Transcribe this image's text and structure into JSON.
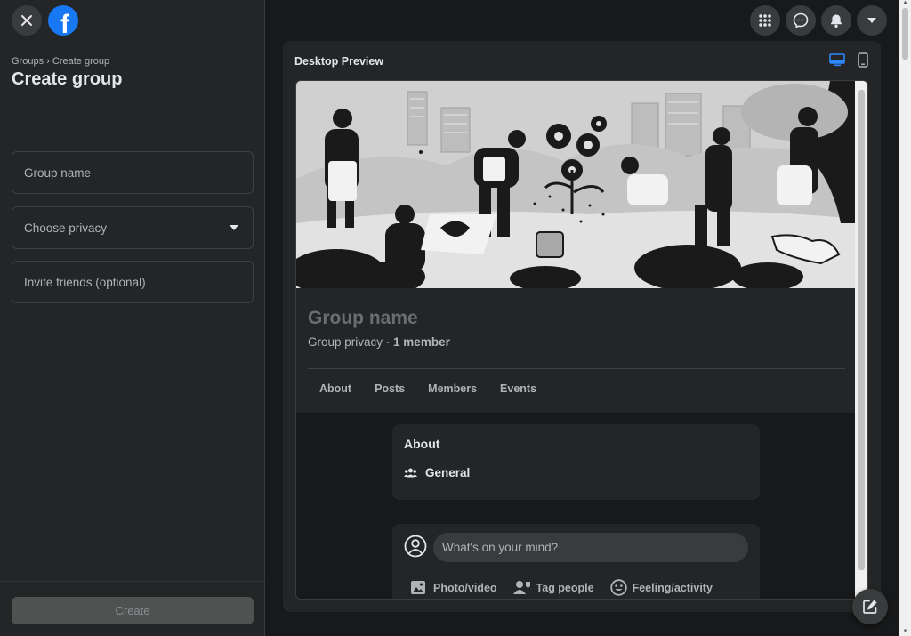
{
  "left": {
    "breadcrumb": {
      "groups": "Groups",
      "separator": "›",
      "current": "Create group"
    },
    "title": "Create group",
    "fields": {
      "group_name_placeholder": "Group name",
      "privacy_placeholder": "Choose privacy",
      "invite_placeholder": "Invite friends (optional)"
    },
    "create_label": "Create"
  },
  "preview": {
    "title": "Desktop Preview",
    "group_name": "Group name",
    "privacy": "Group privacy",
    "separator": " · ",
    "members": "1 member",
    "tabs": [
      "About",
      "Posts",
      "Members",
      "Events"
    ],
    "about": {
      "title": "About",
      "category": "General"
    },
    "composer": {
      "placeholder": "What's on your mind?",
      "actions": [
        "Photo/video",
        "Tag people",
        "Feeling/activity"
      ]
    }
  },
  "colors": {
    "brand": "#1877f2",
    "active_device": "#2d88ff",
    "surface": "#242526",
    "background": "#18191a"
  },
  "icons": [
    "close-icon",
    "facebook-logo",
    "menu-grid-icon",
    "messenger-icon",
    "notifications-bell-icon",
    "account-caret-icon",
    "desktop-icon",
    "mobile-icon",
    "members-icon",
    "profile-avatar-icon",
    "photo-video-icon",
    "tag-people-icon",
    "feeling-icon",
    "edit-compose-icon"
  ]
}
